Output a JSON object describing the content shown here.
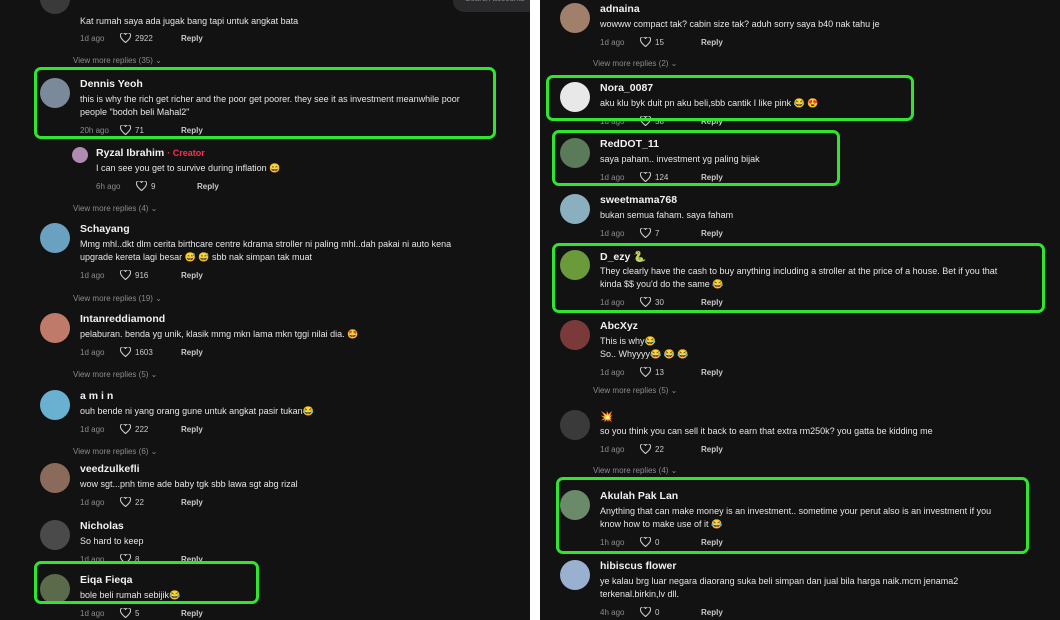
{
  "colors": {
    "background": "#121212",
    "highlight": "#2ee62e",
    "creator_tag": "#fe2c55",
    "meta": "#8a8b91"
  },
  "icons": {
    "like": "heart-outline-icon",
    "more": "chevron-down-icon"
  },
  "left": {
    "search_placeholder": "Search accounts",
    "top_comment": {
      "text": "Kat rumah saya ada jugak bang tapi untuk angkat bata",
      "time": "1d ago",
      "likes": "2922",
      "reply": "Reply"
    },
    "top_more": "View more replies (35)",
    "comments": [
      {
        "username": "Dennis Yeoh",
        "lines": [
          "this is why the rich get richer and the poor get poorer. they see it as investment meanwhile poor",
          "people \"bodoh beli Mahal2\""
        ],
        "time": "20h ago",
        "likes": "71",
        "reply": "Reply"
      },
      {
        "username": "Ryzal Ibrahim",
        "creator": "· Creator",
        "lines": [
          "I can see you get to survive during inflation 😄"
        ],
        "time": "6h ago",
        "likes": "9",
        "reply": "Reply",
        "more": "View more replies (4)"
      },
      {
        "username": "Schayang",
        "lines": [
          "Mmg mhl..dkt dlm cerita birthcare centre kdrama stroller ni paling mhl..dah pakai ni auto kena",
          "upgrade kereta lagi besar 😅 😅 sbb nak simpan tak muat"
        ],
        "time": "1d ago",
        "likes": "916",
        "reply": "Reply",
        "more": "View more replies (19)"
      },
      {
        "username": "Intanreddiamond",
        "lines": [
          "pelaburan. benda yg unik, klasik mmg mkn lama mkn tggi nilai dia. 🤩"
        ],
        "time": "1d ago",
        "likes": "1603",
        "reply": "Reply",
        "more": "View more replies (5)"
      },
      {
        "username": "a m i n",
        "lines": [
          "ouh bende ni yang orang gune untuk angkat pasir tukan😂"
        ],
        "time": "1d ago",
        "likes": "222",
        "reply": "Reply",
        "more": "View more replies (6)"
      },
      {
        "username": "veedzulkefli",
        "lines": [
          "wow sgt...pnh time ade baby tgk sbb lawa sgt abg rizal"
        ],
        "time": "1d ago",
        "likes": "22",
        "reply": "Reply"
      },
      {
        "username": "Nicholas",
        "lines": [
          "So hard to keep"
        ],
        "time": "1d ago",
        "likes": "8",
        "reply": "Reply"
      },
      {
        "username": "Eiqa Fieqa",
        "lines": [
          "bole beli rumah sebijik😂"
        ],
        "time": "1d ago",
        "likes": "5",
        "reply": "Reply"
      }
    ]
  },
  "right": {
    "comments": [
      {
        "username": "adnaina",
        "lines": [
          "wowww compact tak? cabin size tak? aduh sorry saya b40 nak tahu je"
        ],
        "time": "1d ago",
        "likes": "15",
        "reply": "Reply",
        "more": "View more replies (2)"
      },
      {
        "username": "Nora_0087",
        "lines": [
          "aku klu byk duit pn aku beli,sbb cantik I like pink 😂 😍"
        ],
        "time": "1d ago",
        "likes": "58",
        "reply": "Reply"
      },
      {
        "username": "RedDOT_11",
        "lines": [
          "saya paham.. investment yg paling bijak"
        ],
        "time": "1d ago",
        "likes": "124",
        "reply": "Reply"
      },
      {
        "username": "sweetmama768",
        "lines": [
          "bukan semua faham. saya faham"
        ],
        "time": "1d ago",
        "likes": "7",
        "reply": "Reply"
      },
      {
        "username": "D_ezy 🐍",
        "lines": [
          "They clearly have the cash to buy anything including a stroller at the price of a house. Bet if you that",
          "kinda $$ you'd do the same 😂"
        ],
        "time": "1d ago",
        "likes": "30",
        "reply": "Reply"
      },
      {
        "username": "AbcXyz",
        "lines": [
          "This is why😂",
          "So.. Whyyyy😂 😂 😂"
        ],
        "time": "1d ago",
        "likes": "13",
        "reply": "Reply",
        "more": "View more replies (5)"
      },
      {
        "username": "💥",
        "lines": [
          "so you think you can sell it back to earn that extra rm250k? you gatta be kidding me"
        ],
        "time": "1d ago",
        "likes": "22",
        "reply": "Reply",
        "more": "View more replies (4)"
      },
      {
        "username": "Akulah Pak Lan",
        "lines": [
          "Anything that can make money is an investment.. sometime your perut also is an investment if you",
          "know how to make use of it 😂"
        ],
        "time": "1h ago",
        "likes": "0",
        "reply": "Reply"
      },
      {
        "username": "hibiscus flower",
        "lines": [
          "ye kalau brg luar negara diaorang suka beli simpan dan jual bila harga naik.mcm jenama2",
          "terkenal.birkin,lv dll."
        ],
        "time": "4h ago",
        "likes": "0",
        "reply": "Reply"
      }
    ]
  }
}
